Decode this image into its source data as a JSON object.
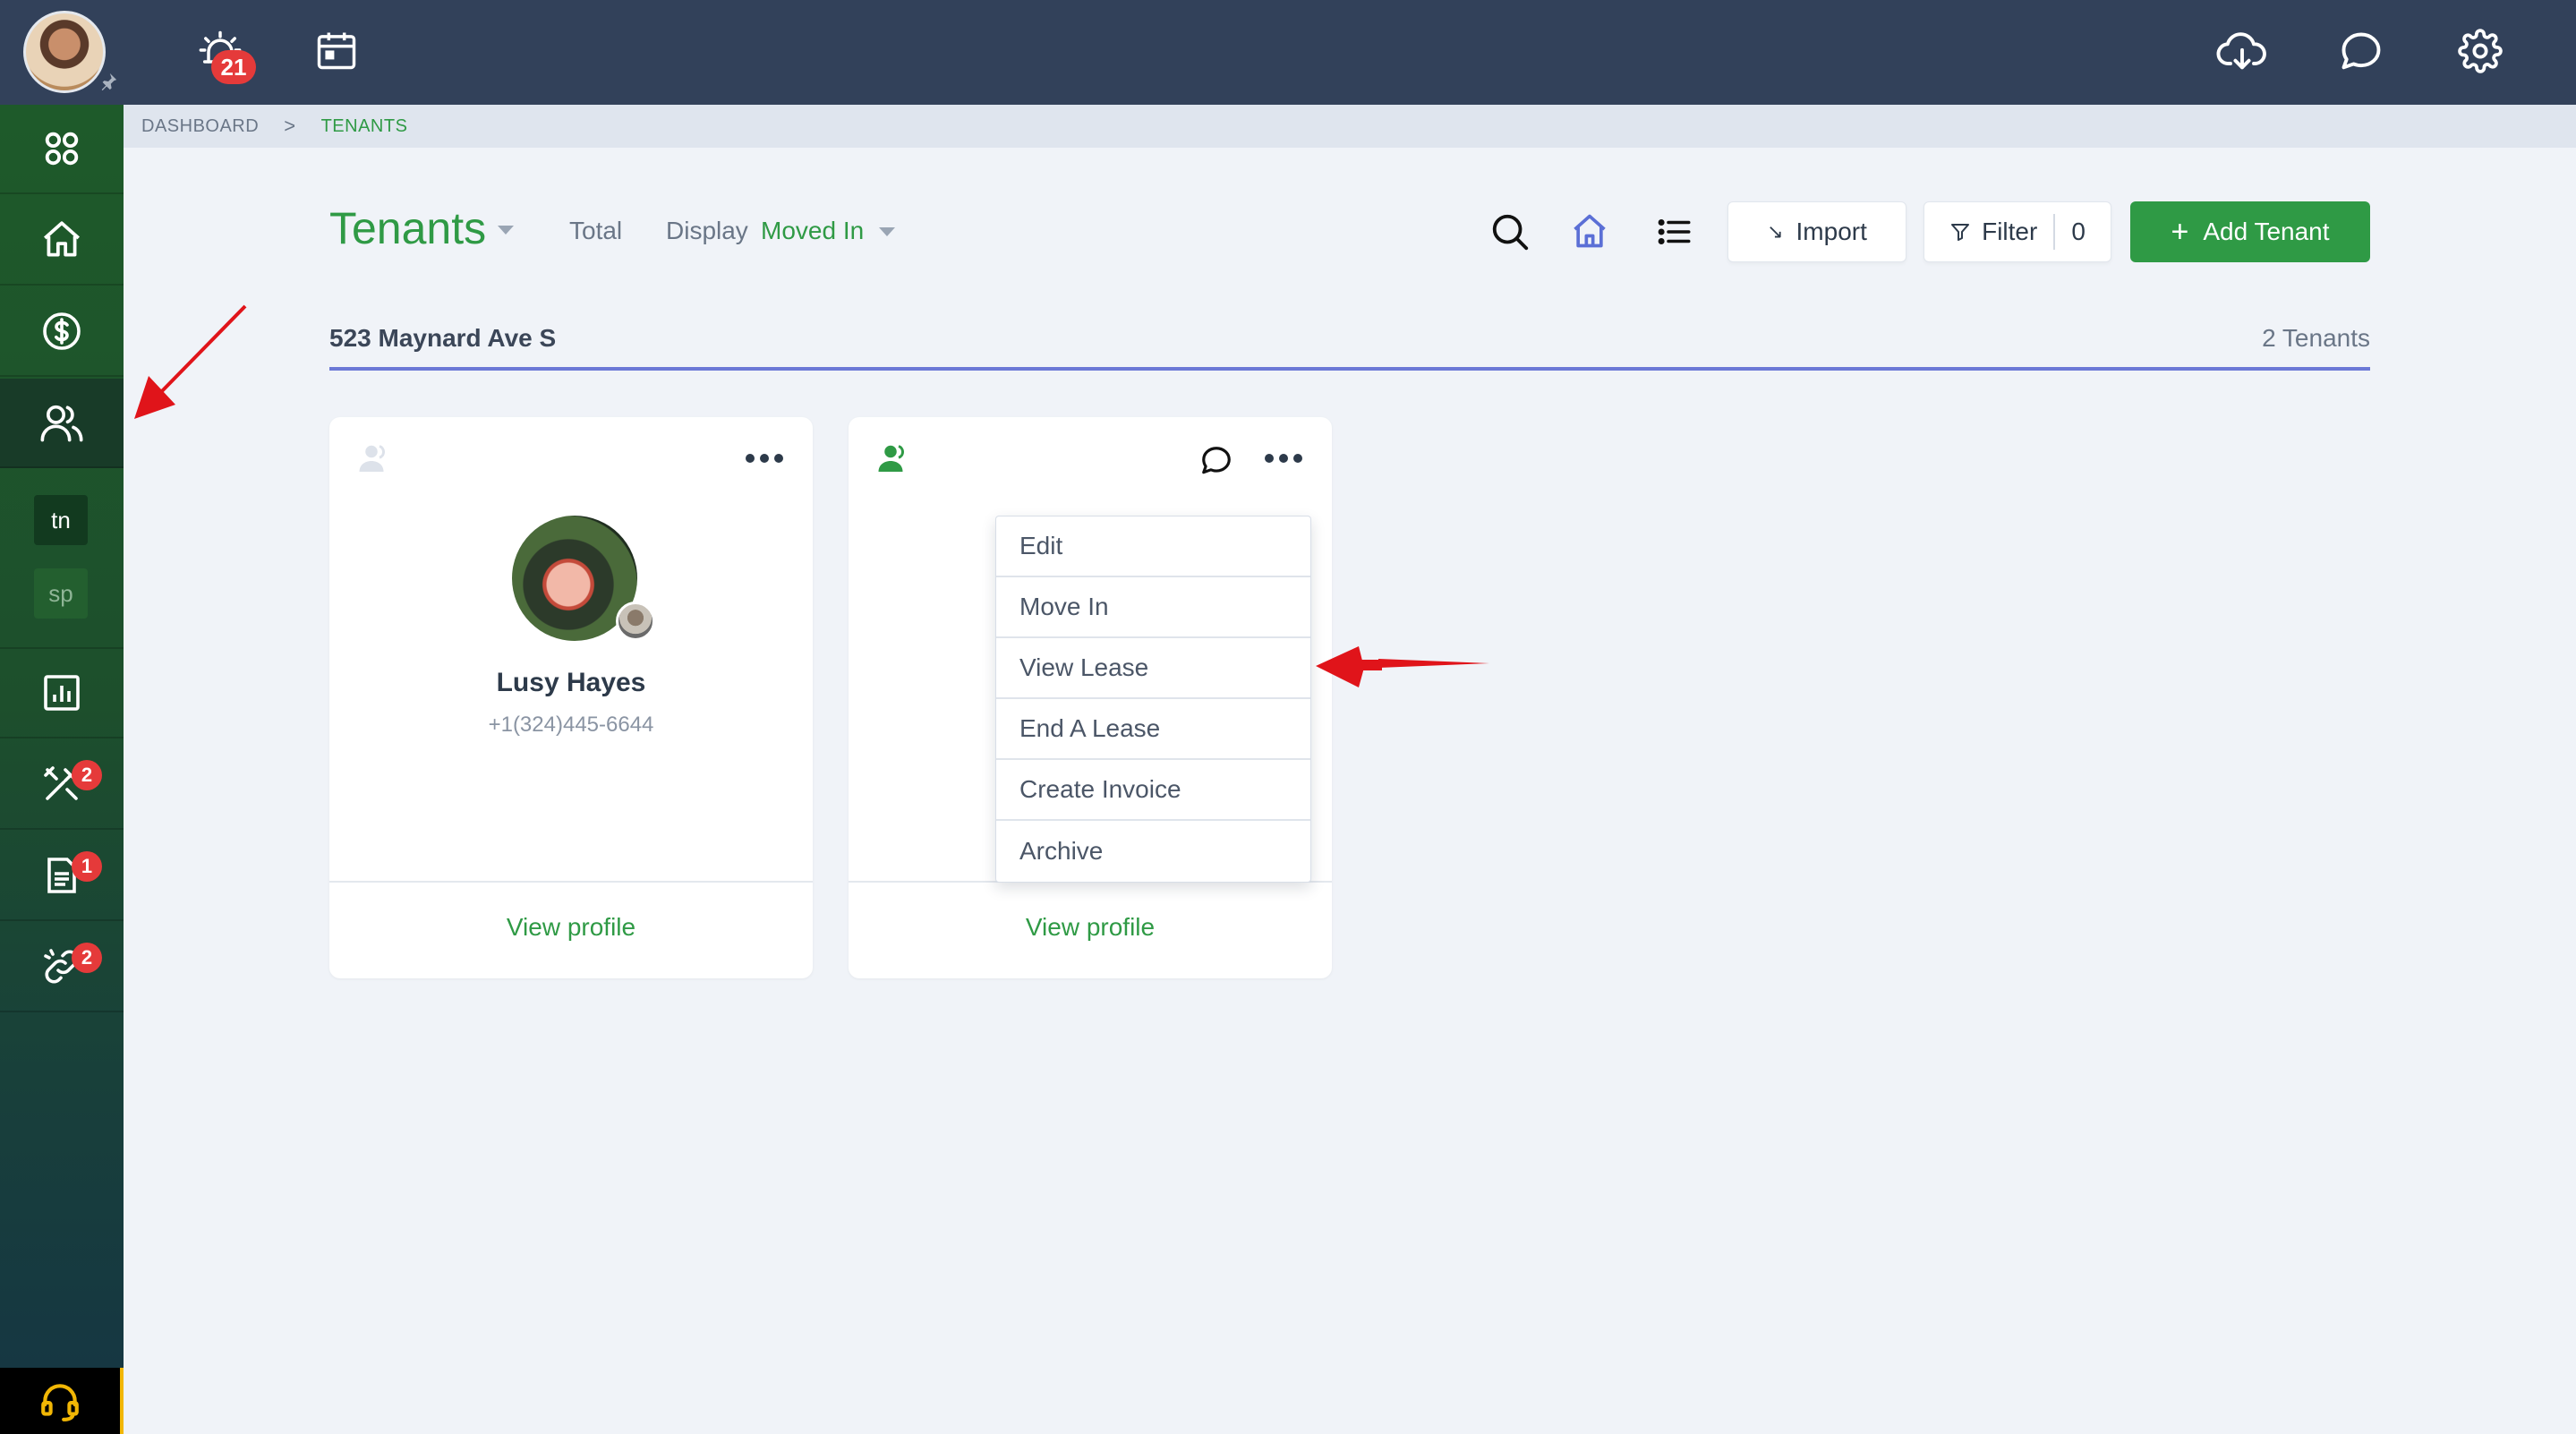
{
  "topbar": {
    "notifications_count": "21",
    "icons": [
      "alarm-icon",
      "calendar-icon",
      "cloud-download-icon",
      "chat-icon",
      "gear-icon"
    ]
  },
  "sidebar": {
    "items": [
      {
        "name": "apps",
        "icon": "grid-icon"
      },
      {
        "name": "home",
        "icon": "home-icon"
      },
      {
        "name": "payments",
        "icon": "dollar-icon"
      },
      {
        "name": "tenants",
        "icon": "users-icon",
        "active": true
      },
      {
        "name": "reports",
        "icon": "chart-icon"
      },
      {
        "name": "maintenance",
        "icon": "tools-icon",
        "badge": "2"
      },
      {
        "name": "documents",
        "icon": "document-icon",
        "badge": "1"
      },
      {
        "name": "links",
        "icon": "link-icon",
        "badge": "2"
      }
    ],
    "tags": [
      "tn",
      "sp"
    ],
    "support_icon": "headset-icon"
  },
  "breadcrumb": {
    "items": [
      "DASHBOARD",
      "TENANTS"
    ],
    "separator": ">"
  },
  "header": {
    "title": "Tenants",
    "total_label": "Total",
    "display_label": "Display",
    "display_value": "Moved In",
    "import_label": "Import",
    "filter_label": "Filter",
    "filter_count": "0",
    "add_label": "Add Tenant"
  },
  "property": {
    "name": "523 Maynard Ave S",
    "count": "2 Tenants"
  },
  "cards": [
    {
      "name": "Lusy Hayes",
      "phone": "+1(324)445-6644",
      "link": "View profile"
    },
    {
      "name": "",
      "phone": "",
      "link": "View profile"
    }
  ],
  "menu": {
    "items": [
      "Edit",
      "Move In",
      "View Lease",
      "End A Lease",
      "Create Invoice",
      "Archive"
    ]
  },
  "colors": {
    "brand_green": "#2f9a45",
    "topbar": "#32415a",
    "accent_blue": "#6b78d6",
    "badge_red": "#e53a3a",
    "annotation_red": "#e0141a"
  }
}
